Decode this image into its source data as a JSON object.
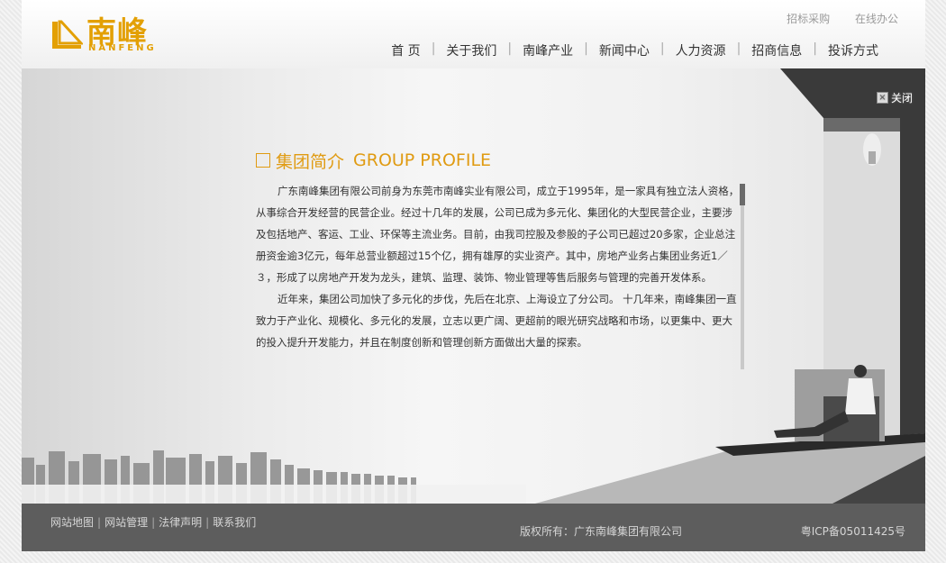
{
  "brand": {
    "name_cn": "南峰",
    "name_en": "NANFENG",
    "color": "#e3a004"
  },
  "top_links": [
    "招标采购",
    "在线办公"
  ],
  "nav": [
    "首 页",
    "关于我们",
    "南峰产业",
    "新闻中心",
    "人力资源",
    "招商信息",
    "投诉方式"
  ],
  "hero": {
    "close_label": "关闭",
    "title_cn": "集团简介",
    "title_en": "GROUP PROFILE",
    "paragraphs": [
      "广东南峰集团有限公司前身为东莞市南峰实业有限公司，成立于1995年，是一家具有独立法人资格，从事综合开发经营的民营企业。经过十几年的发展，公司已成为多元化、集团化的大型民营企业，主要涉及包括地产、客运、工业、环保等主流业务。目前，由我司控股及参股的子公司已超过20多家，企业总注册资金逾3亿元，每年总营业额超过15个亿，拥有雄厚的实业资产。其中，房地产业务占集团业务近1／３，形成了以房地产开发为龙头，建筑、监理、装饰、物业管理等售后服务与管理的完善开发体系。",
      "近年来，集团公司加快了多元化的步伐，先后在北京、上海设立了分公司。 十几年来，南峰集团一直致力于产业化、规模化、多元化的发展，立志以更广阔、更超前的眼光研究战略和市场，以更集中、更大的投入提升开发能力，并且在制度创新和管理创新方面做出大量的探索。"
    ]
  },
  "footer": {
    "links": [
      "网站地图",
      "网站管理",
      "法律声明",
      "联系我们"
    ],
    "copyright": "版权所有：广东南峰集团有限公司",
    "icp": "粤ICP备05011425号"
  }
}
